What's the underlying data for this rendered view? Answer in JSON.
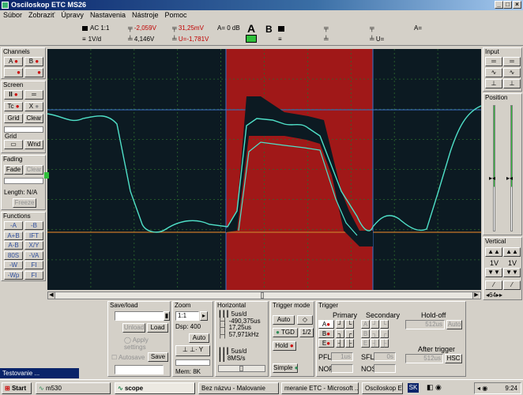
{
  "window": {
    "title": "Osciloskop ETC MS26"
  },
  "menu": [
    "Súbor",
    "Zobraziť",
    "Úpravy",
    "Nastavenia",
    "Nástroje",
    "Pomoc"
  ],
  "infobar": {
    "ch_a_coupling": "AC 1:1",
    "ch_a_scale": "1V/d",
    "cursor_t1": "-2,059V",
    "cursor_t2": "4,146V",
    "cursor_f1": "31,25mV",
    "cursor_f2": "U=-1,781V",
    "db": "A= 0 dB",
    "label_a": "A",
    "label_b": "B",
    "b_delta": "A=",
    "b_u": "U="
  },
  "left": {
    "channels_title": "Channels",
    "ch_a": "A",
    "ch_b": "B",
    "screen_title": "Screen",
    "tc": "Tc",
    "x": "X",
    "grid": "Grid",
    "clear": "Clear",
    "grid2": "Grid",
    "wnd": "Wnd",
    "fading_title": "Fading",
    "fade": "Fade",
    "clear2": "Clear",
    "length": "Length: N/A",
    "freeze": "Freeze",
    "functions_title": "Functions",
    "functions": [
      [
        "-A",
        "-B"
      ],
      [
        "A+B",
        "IFT"
      ],
      [
        "A-B",
        "X/Y"
      ],
      [
        "80S",
        "-VA"
      ],
      [
        "-W",
        "FI"
      ],
      [
        "-Wp",
        "FI"
      ]
    ]
  },
  "right": {
    "input_title": "Input",
    "position_title": "Position",
    "vertical_title": "Vertical",
    "v1": "1V",
    "v2": "1V",
    "h64": "64"
  },
  "bottom": {
    "save_title": "Save/load",
    "unload": "Unload",
    "load": "Load",
    "apply": "Apply settings",
    "autosave": "Autosave",
    "save": "Save",
    "zoom_title": "Zoom",
    "zoom_ratio": "1:1",
    "dsp": "Dsp: 400",
    "auto": "Auto",
    "mem": "Mem: 8K",
    "horiz_title": "Horizontal",
    "h_time": "5us/d",
    "h_pos": "-490,375us",
    "h_period": "17,25us",
    "h_freq": "57,971kHz",
    "h_time2": "5us/d",
    "h_rate": "8MS/s",
    "trig_mode_title": "Trigger mode",
    "auto2": "Auto",
    "tgd": "TGD",
    "hold": "Hold",
    "half": "1/2",
    "simple": "Simple",
    "trigger_title": "Trigger",
    "primary": "Primary",
    "secondary": "Secondary",
    "holdoff": "Hold-off",
    "holdoff_val": "512us",
    "auto3": "Auto",
    "pfl": "PFL",
    "pfl_val": "1us",
    "sfl": "SFL",
    "sfl_val": "0s",
    "nop": "NOP",
    "nos": "NOS",
    "after_trigger": "After trigger",
    "after_val": "512us",
    "hsc": "HSC",
    "ta": "A",
    "tb": "B",
    "te": "E"
  },
  "status_tab": "Testovanie ...",
  "taskbar": {
    "start": "Start",
    "items": [
      "m530",
      "scope",
      "Bez názvu - Malovanie",
      "meranie ETC - Microsoft ...",
      "Osciloskop ETC M..."
    ],
    "lang": "SK",
    "time": "9:24"
  },
  "colors": {
    "trace": "#4fe0c8",
    "highlight": "#a01818",
    "grid": "#2d6a2d",
    "title_bar": "#0a246a"
  }
}
